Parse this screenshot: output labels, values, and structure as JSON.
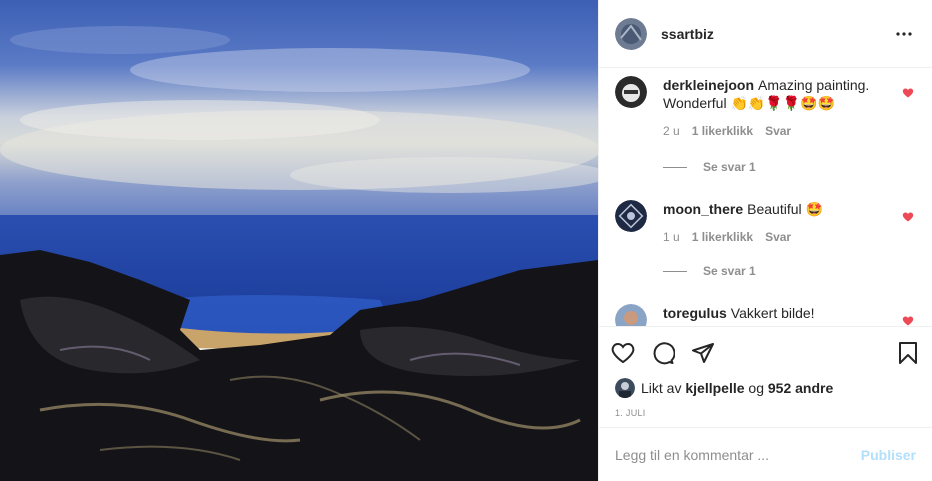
{
  "post": {
    "author": "ssartbiz",
    "more_icon": "more-horizontal-icon"
  },
  "comments": [
    {
      "username": "derkleinejoon",
      "text": "Amazing painting. Wonderful",
      "emojis": "👏👏🌹🌹🤩🤩",
      "time": "2 u",
      "likes": "1 likerklikk",
      "reply_label": "Svar",
      "view_replies": "Se svar 1"
    },
    {
      "username": "moon_there",
      "text": "Beautiful",
      "emojis": "🤩",
      "time": "1 u",
      "likes": "1 likerklikk",
      "reply_label": "Svar",
      "view_replies": "Se svar 1"
    },
    {
      "username": "toregulus",
      "text": "Vakkert bilde!"
    }
  ],
  "actions": {
    "like_icon": "heart-icon",
    "comment_icon": "comment-icon",
    "share_icon": "share-icon",
    "save_icon": "bookmark-icon"
  },
  "likes": {
    "prefix": "Likt av",
    "user": "kjellpelle",
    "joiner": "og",
    "others": "952 andre"
  },
  "date": "1. JULI",
  "add_comment": {
    "placeholder": "Legg til en kommentar ...",
    "publish_label": "Publiser"
  },
  "colors": {
    "heart_red": "#ed4956",
    "publish_disabled": "#b2dffc",
    "muted": "#8e8e8e",
    "text": "#262626"
  }
}
